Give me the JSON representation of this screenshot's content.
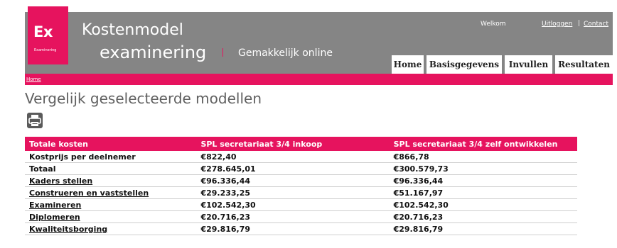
{
  "header": {
    "logo_text": "Ex",
    "logo_sub": "Examinering",
    "title_line1": "Kostenmodel",
    "title_line2": "examinering",
    "separator": "|",
    "tagline": "Gemakkelijk online",
    "welcome": "Welkom",
    "logout": "Uitloggen",
    "link_separator": "|",
    "contact": "Contact"
  },
  "nav": {
    "tabs": [
      {
        "label": "Home"
      },
      {
        "label": "Basisgegevens"
      },
      {
        "label": "Invullen"
      },
      {
        "label": "Resultaten"
      }
    ]
  },
  "breadcrumb": {
    "home": "Home"
  },
  "page": {
    "title": "Vergelijk geselecteerde modellen"
  },
  "icons": {
    "print": "printer-icon"
  },
  "colors": {
    "accent": "#e6135e",
    "header_bg": "#858585"
  },
  "table": {
    "headers": [
      "Totale kosten",
      "SPL secretariaat 3/4 inkoop",
      "SPL secretariaat 3/4 zelf ontwikkelen"
    ],
    "rows": [
      {
        "label": "Kostprijs per deelnemer",
        "v1": "€822,40",
        "v2": "€866,78",
        "link": false
      },
      {
        "label": "Totaal",
        "v1": "€278.645,01",
        "v2": "€300.579,73",
        "link": false
      },
      {
        "label": "Kaders stellen",
        "v1": "€96.336,44",
        "v2": "€96.336,44",
        "link": true
      },
      {
        "label": "Construeren en vaststellen",
        "v1": "€29.233,25",
        "v2": "€51.167,97",
        "link": true
      },
      {
        "label": "Examineren",
        "v1": "€102.542,30",
        "v2": "€102.542,30",
        "link": true
      },
      {
        "label": "Diplomeren",
        "v1": "€20.716,23",
        "v2": "€20.716,23",
        "link": true
      },
      {
        "label": "Kwaliteitsborging",
        "v1": "€29.816,79",
        "v2": "€29.816,79",
        "link": true
      }
    ]
  }
}
